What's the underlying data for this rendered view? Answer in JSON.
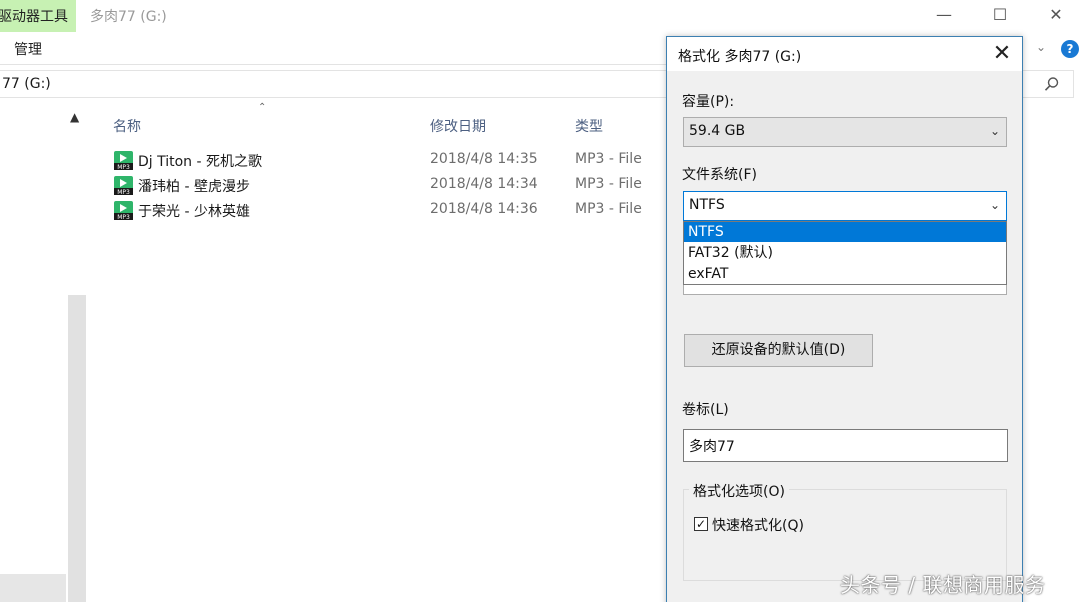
{
  "titlebar": {
    "context_tab": "驱动器工具",
    "title": "多肉77 (G:)",
    "minimize": "—",
    "maximize": "☐",
    "close": "✕"
  },
  "ribbon": {
    "manage_tab": "管理",
    "expand_icon": "chevron-down-icon",
    "help": "?"
  },
  "address": {
    "path": "77 (G:)"
  },
  "columns": {
    "name": "名称",
    "date": "修改日期",
    "type": "类型"
  },
  "files": [
    {
      "name": "Dj Titon - 死机之歌",
      "date": "2018/4/8 14:35",
      "type": "MP3 - File"
    },
    {
      "name": "潘玮柏 - 壁虎漫步",
      "date": "2018/4/8 14:34",
      "type": "MP3 - File"
    },
    {
      "name": "于荣光 - 少林英雄",
      "date": "2018/4/8 14:36",
      "type": "MP3 - File"
    }
  ],
  "dialog": {
    "title": "格式化 多肉77 (G:)",
    "capacity_label": "容量(P):",
    "capacity_value": "59.4 GB",
    "filesystem_label": "文件系统(F)",
    "filesystem_value": "NTFS",
    "filesystem_options": [
      "NTFS",
      "FAT32 (默认)",
      "exFAT"
    ],
    "restore_button": "还原设备的默认值(D)",
    "volume_label": "卷标(L)",
    "volume_value": "多肉77",
    "options_group": "格式化选项(O)",
    "quick_format": "快速格式化(Q)",
    "quick_format_checked": true
  },
  "watermark": "头条号 / 联想商用服务",
  "colors": {
    "context_tab_bg": "#c7f1b3",
    "accent": "#0078d7",
    "help_icon": "#1979d4"
  }
}
